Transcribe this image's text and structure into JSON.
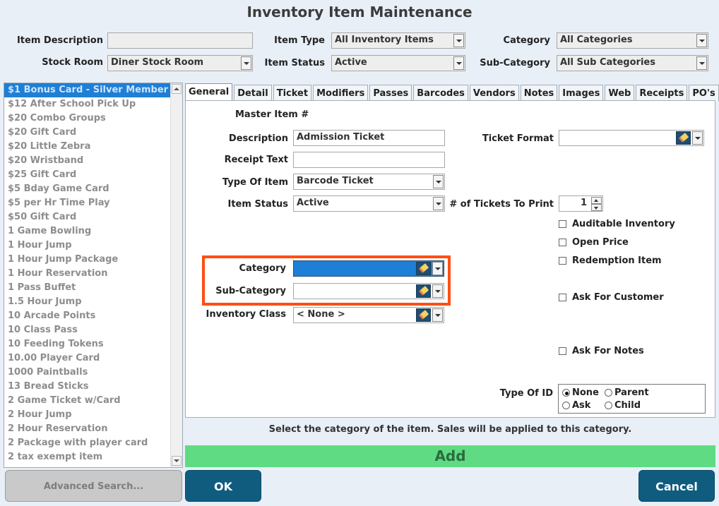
{
  "window": {
    "title": "Inventory Item Maintenance"
  },
  "filters": {
    "item_description_label": "Item Description",
    "item_description_value": "",
    "item_type_label": "Item Type",
    "item_type_value": "All Inventory Items",
    "category_label": "Category",
    "category_value": "All Categories",
    "stock_room_label": "Stock Room",
    "stock_room_value": "Diner Stock Room",
    "item_status_label": "Item Status",
    "item_status_value": "Active",
    "sub_category_label": "Sub-Category",
    "sub_category_value": "All Sub Categories"
  },
  "item_list": [
    "$1 Bonus Card -  Silver Member",
    "$12 After School Pick Up",
    "$20 Combo Groups",
    "$20 Gift Card",
    "$20 Little Zebra",
    "$20 Wristband",
    "$25 Gift Card",
    "$5 Bday Game Card",
    "$5 per Hr Time Play",
    "$50 Gift Card",
    "1 Game Bowling",
    "1 Hour Jump",
    "1 Hour Jump Package",
    "1 Hour Reservation",
    "1 Pass Buffet",
    "1.5 Hour Jump",
    "10 Arcade Points",
    "10 Class Pass",
    "10 Feeding Tokens",
    "10.00 Player Card",
    "1000 Paintballs",
    "13 Bread Sticks",
    "2 Game Ticket w/Card",
    "2 Hour Jump",
    "2 Hour Reservation",
    "2 Package with player card",
    "2 tax exempt item"
  ],
  "tabs": [
    "General",
    "Detail",
    "Ticket",
    "Modifiers",
    "Passes",
    "Barcodes",
    "Vendors",
    "Notes",
    "Images",
    "Web",
    "Receipts",
    "PO's"
  ],
  "general": {
    "master_item_label": "Master Item #",
    "description_label": "Description",
    "description_value": "Admission Ticket",
    "receipt_text_label": "Receipt Text",
    "receipt_text_value": "",
    "type_of_item_label": "Type Of Item",
    "type_of_item_value": "Barcode Ticket",
    "item_status_label": "Item Status",
    "item_status_value": "Active",
    "category_label": "Category",
    "category_value": "",
    "sub_category_label": "Sub-Category",
    "sub_category_value": "",
    "inventory_class_label": "Inventory Class",
    "inventory_class_value": "< None >",
    "ticket_format_label": "Ticket Format",
    "ticket_format_value": "",
    "tickets_to_print_label": "# of Tickets To Print",
    "tickets_to_print_value": "1",
    "auditable_label": "Auditable Inventory",
    "open_price_label": "Open Price",
    "redemption_label": "Redemption Item",
    "ask_customer_label": "Ask For Customer",
    "ask_notes_label": "Ask For Notes",
    "type_of_id_label": "Type Of ID",
    "type_of_id_options": [
      "None",
      "Parent",
      "Ask",
      "Child"
    ]
  },
  "hint_text": "Select the category of the item.  Sales will be applied to this category.",
  "buttons": {
    "add": "Add",
    "advanced_search": "Advanced Search...",
    "ok": "OK",
    "cancel": "Cancel"
  },
  "colors": {
    "accent": "#1e7fd7",
    "add_bar": "#5fdc83",
    "button_dark": "#0f5c7f",
    "highlight": "#ff4e14"
  }
}
